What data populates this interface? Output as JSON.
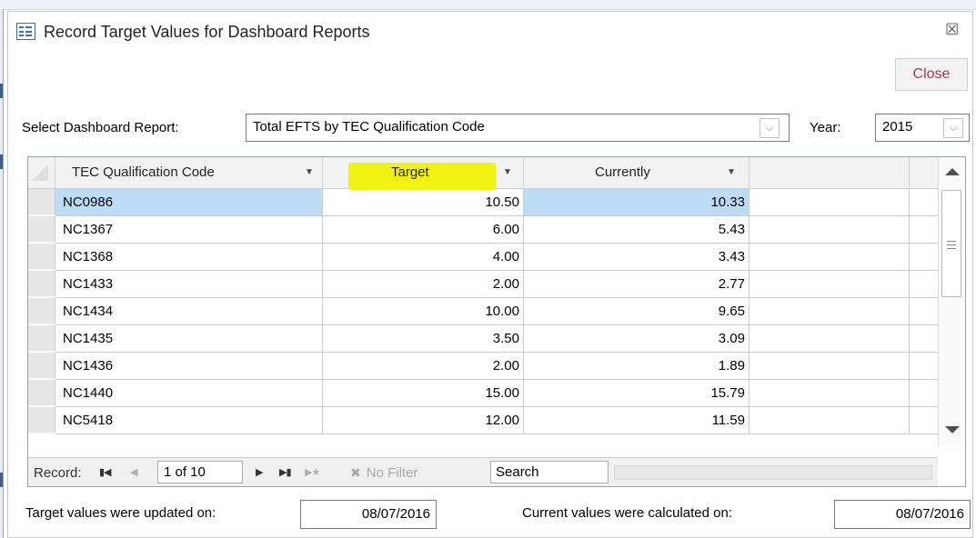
{
  "window": {
    "title": "Record Target Values for Dashboard Reports",
    "close_glyph": "☒",
    "close_button_label": "Close"
  },
  "filters": {
    "report_label": "Select Dashboard Report:",
    "report_value": "Total EFTS by TEC Qualification Code",
    "year_label": "Year:",
    "year_value": "2015"
  },
  "grid": {
    "columns": [
      "TEC Qualification Code",
      "Target",
      "Currently"
    ],
    "highlight_color": "#f2f212",
    "rows": [
      {
        "code": "NC0986",
        "target": "10.50",
        "current": "10.33"
      },
      {
        "code": "NC1367",
        "target": "6.00",
        "current": "5.43"
      },
      {
        "code": "NC1368",
        "target": "4.00",
        "current": "3.43"
      },
      {
        "code": "NC1433",
        "target": "2.00",
        "current": "2.77"
      },
      {
        "code": "NC1434",
        "target": "10.00",
        "current": "9.65"
      },
      {
        "code": "NC1435",
        "target": "3.50",
        "current": "3.09"
      },
      {
        "code": "NC1436",
        "target": "2.00",
        "current": "1.89"
      },
      {
        "code": "NC1440",
        "target": "15.00",
        "current": "15.79"
      },
      {
        "code": "NC5418",
        "target": "12.00",
        "current": "11.59"
      }
    ]
  },
  "navigation": {
    "record_label": "Record:",
    "position": "1 of 10",
    "filter_label": "No Filter",
    "search_placeholder": "Search"
  },
  "footer": {
    "updated_label": "Target values were updated on:",
    "updated_value": "08/07/2016",
    "calculated_label": "Current values were calculated on:",
    "calculated_value": "08/07/2016"
  }
}
